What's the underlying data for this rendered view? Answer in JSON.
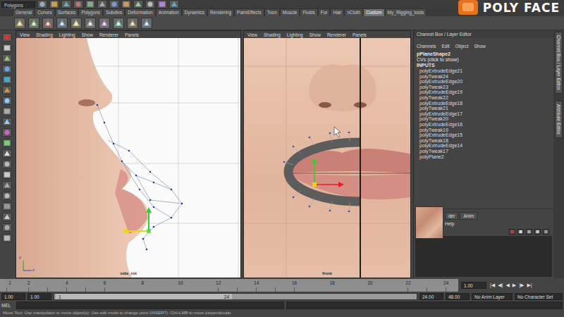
{
  "mode_menu": {
    "label": "Polygons"
  },
  "logo": {
    "text": "POLY FACE"
  },
  "shelf_tabs": [
    {
      "label": "General",
      "selected": false
    },
    {
      "label": "Curves",
      "selected": false
    },
    {
      "label": "Surfaces",
      "selected": false
    },
    {
      "label": "Polygons",
      "selected": false
    },
    {
      "label": "Subdivs",
      "selected": false
    },
    {
      "label": "Deformation",
      "selected": false
    },
    {
      "label": "Animation",
      "selected": false
    },
    {
      "label": "Dynamics",
      "selected": false
    },
    {
      "label": "Rendering",
      "selected": false
    },
    {
      "label": "PaintEffects",
      "selected": false
    },
    {
      "label": "Toon",
      "selected": false
    },
    {
      "label": "Muscle",
      "selected": false
    },
    {
      "label": "Fluids",
      "selected": false
    },
    {
      "label": "Fur",
      "selected": false
    },
    {
      "label": "Hair",
      "selected": false
    },
    {
      "label": "nCloth",
      "selected": false
    },
    {
      "label": "Custom",
      "selected": true
    },
    {
      "label": "My_Rigging_tools",
      "selected": false
    }
  ],
  "viewports": [
    {
      "menu": [
        "View",
        "Shading",
        "Lighting",
        "Show",
        "Renderer",
        "Panels"
      ],
      "label": "side_rot",
      "axes": [
        "y",
        "z"
      ]
    },
    {
      "menu": [
        "View",
        "Shading",
        "Lighting",
        "Show",
        "Renderer",
        "Panels"
      ],
      "label": "front",
      "axes": []
    }
  ],
  "channel_box": {
    "title": "Channel Box / Layer Editor",
    "menu": [
      "Channels",
      "Edit",
      "Object",
      "Show"
    ],
    "object": "pPlaneShape2",
    "cvs": "CVs (click to show)",
    "inputs_header": "INPUTS",
    "inputs": [
      "polyExtrudeEdge21",
      "polyTweak24",
      "polyExtrudeEdge20",
      "polyTweak23",
      "polyExtrudeEdge19",
      "polyTweak22",
      "polyExtrudeEdge18",
      "polyTweak21",
      "polyExtrudeEdge17",
      "polyTweak20",
      "polyExtrudeEdge16",
      "polyTweak19",
      "polyExtrudeEdge15",
      "polyTweak18",
      "polyExtrudeEdge14",
      "polyTweak17",
      "polyPlane2"
    ]
  },
  "side_tabs": [
    "Channel Box / Layer Editor",
    "Attribute Editor"
  ],
  "layer_editor": {
    "tabs": [
      {
        "label": "der",
        "selected": false
      },
      {
        "label": "Anim",
        "selected": false
      }
    ],
    "menu": [
      "Help"
    ]
  },
  "timeline": {
    "ticks": [
      "1",
      "2",
      "4",
      "6",
      "8",
      "10",
      "12",
      "14",
      "16",
      "18",
      "20",
      "22",
      "24"
    ],
    "current_frame": "1.00",
    "playback": [
      "|◀",
      "◀|",
      "◀",
      "▶",
      "|▶",
      "▶|"
    ]
  },
  "range": {
    "start": "1.00",
    "inner_start": "1.00",
    "slider_start": "1",
    "slider_end": "24",
    "inner_end": "24.00",
    "end": "48.00",
    "anim_layer": "No Anim Layer",
    "character_set": "No Character Set"
  },
  "command_line": {
    "label": "MEL"
  },
  "help_line": "Move Tool: Use manipulator to move object(s). Use edit mode to change pivot (INSERT). Ctrl+LMB to move perpendicular."
}
